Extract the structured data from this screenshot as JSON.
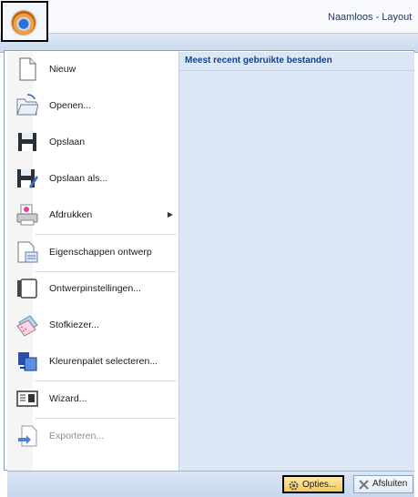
{
  "window": {
    "title": "Naamloos - Layout"
  },
  "menu_items": [
    {
      "label": "Nieuw",
      "icon": "new-document-icon",
      "disabled": false
    },
    {
      "label": "Openen...",
      "icon": "open-folder-icon",
      "disabled": false
    },
    {
      "label": "Opslaan",
      "icon": "save-disk-icon",
      "disabled": false
    },
    {
      "label": "Opslaan als...",
      "icon": "save-as-icon",
      "disabled": false
    },
    {
      "label": "Afdrukken",
      "icon": "printer-icon",
      "disabled": false,
      "submenu": true
    },
    {
      "label": "Eigenschappen ontwerp",
      "icon": "design-properties-icon",
      "disabled": false
    },
    {
      "label": "Ontwerpinstellingen...",
      "icon": "design-settings-icon",
      "disabled": false
    },
    {
      "label": "Stofkiezer...",
      "icon": "fabric-selector-icon",
      "disabled": false
    },
    {
      "label": "Kleurenpalet selecteren...",
      "icon": "color-palette-icon",
      "disabled": false
    },
    {
      "label": "Wizard...",
      "icon": "wizard-icon",
      "disabled": false
    },
    {
      "label": "Exporteren...",
      "icon": "export-icon",
      "disabled": true
    }
  ],
  "recent": {
    "header": "Meest recent gebruikte bestanden"
  },
  "footer": {
    "options_label": "Opties...",
    "exit_label": "Afsluiten"
  }
}
